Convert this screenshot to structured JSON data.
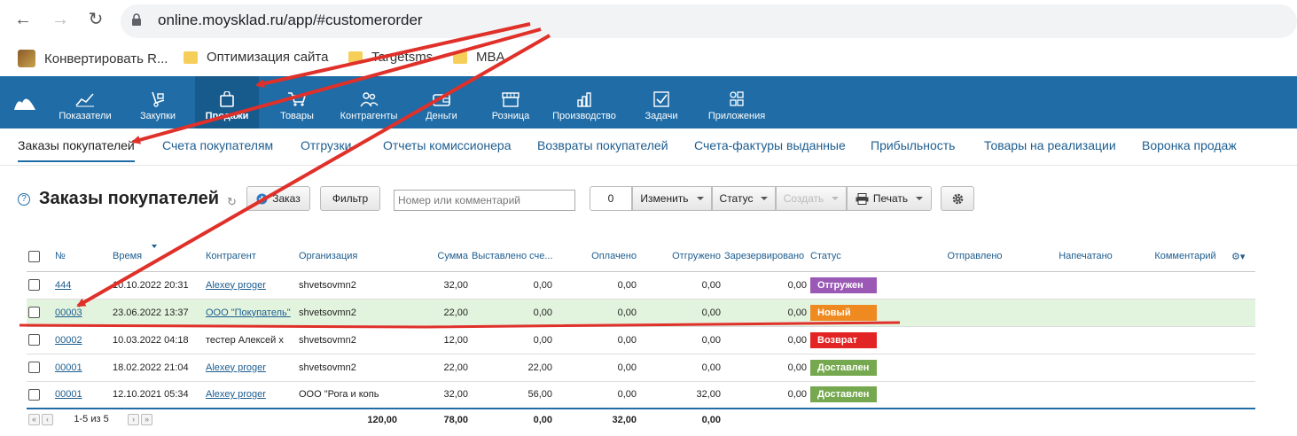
{
  "browser": {
    "url": "online.moysklad.ru/app/#customerorder",
    "bookmarks": [
      "Конвертировать R...",
      "Оптимизация сайта",
      "Targetsms",
      "MBA"
    ]
  },
  "app_nav": {
    "items": [
      {
        "label": "Показатели",
        "icon": "chart-line-icon"
      },
      {
        "label": "Закупки",
        "icon": "hand-truck-icon"
      },
      {
        "label": "Продажи",
        "icon": "shopping-bag-icon",
        "active": true
      },
      {
        "label": "Товары",
        "icon": "cart-icon"
      },
      {
        "label": "Контрагенты",
        "icon": "people-icon"
      },
      {
        "label": "Деньги",
        "icon": "wallet-icon"
      },
      {
        "label": "Розница",
        "icon": "store-icon"
      },
      {
        "label": "Производство",
        "icon": "bar-chart-icon"
      },
      {
        "label": "Задачи",
        "icon": "checkbox-icon"
      },
      {
        "label": "Приложения",
        "icon": "apps-grid-icon"
      }
    ]
  },
  "subnav": {
    "items": [
      "Заказы покупателей",
      "Счета покупателям",
      "Отгрузки",
      "Отчеты комиссионера",
      "Возвраты покупателей",
      "Счета-фактуры выданные",
      "Прибыльность",
      "Товары на реализации",
      "Воронка продаж"
    ]
  },
  "toolbar": {
    "title": "Заказы покупателей",
    "order_button": "Заказ",
    "filter_button": "Фильтр",
    "search_placeholder": "Номер или комментарий",
    "selected_count": "0",
    "change_button": "Изменить",
    "status_button": "Статус",
    "create_button": "Создать",
    "print_button": "Печать"
  },
  "table": {
    "headers": {
      "number": "№",
      "time": "Время",
      "counterparty": "Контрагент",
      "organization": "Организация",
      "sum": "Сумма",
      "invoiced": "Выставлено сче...",
      "paid": "Оплачено",
      "shipped": "Отгружено",
      "reserved": "Зарезервировано",
      "status": "Статус",
      "sent": "Отправлено",
      "printed": "Напечатано",
      "comment": "Комментарий"
    },
    "rows": [
      {
        "number": "444",
        "time": "10.10.2022 20:31",
        "counterparty": "Alexey proger",
        "organization": "shvetsovmn2",
        "sum": "32,00",
        "invoiced": "0,00",
        "paid": "0,00",
        "shipped": "0,00",
        "reserved": "0,00",
        "status": "Отгружен",
        "status_color": "#9b59b6"
      },
      {
        "number": "00003",
        "time": "23.06.2022 13:37",
        "counterparty": "ООО \"Покупатель\"",
        "organization": "shvetsovmn2",
        "sum": "22,00",
        "invoiced": "0,00",
        "paid": "0,00",
        "shipped": "0,00",
        "reserved": "0,00",
        "status": "Новый",
        "status_color": "#ee8a1f"
      },
      {
        "number": "00002",
        "time": "10.03.2022 04:18",
        "counterparty": "тестер Алексей х",
        "organization": "shvetsovmn2",
        "sum": "12,00",
        "invoiced": "0,00",
        "paid": "0,00",
        "shipped": "0,00",
        "reserved": "0,00",
        "status": "Возврат",
        "status_color": "#e32424"
      },
      {
        "number": "00001",
        "time": "18.02.2022 21:04",
        "counterparty": "Alexey proger",
        "organization": "shvetsovmn2",
        "sum": "22,00",
        "invoiced": "22,00",
        "paid": "0,00",
        "shipped": "0,00",
        "reserved": "0,00",
        "status": "Доставлен",
        "status_color": "#75a84f"
      },
      {
        "number": "00001",
        "time": "12.10.2021 05:34",
        "counterparty": "Alexey proger",
        "organization": "ООО \"Рога и копь",
        "sum": "32,00",
        "invoiced": "56,00",
        "paid": "0,00",
        "shipped": "32,00",
        "reserved": "0,00",
        "status": "Доставлен",
        "status_color": "#75a84f"
      }
    ],
    "footer": {
      "pagination": "1-5 из 5",
      "sum": "120,00",
      "invoiced": "78,00",
      "paid": "0,00",
      "shipped": "32,00",
      "reserved": "0,00"
    }
  },
  "colors": {
    "app_bar": "#1f6ca6",
    "link": "#1d5d8f",
    "row_highlight": "#e3f4de",
    "annotation_arrow": "#e0302a"
  }
}
